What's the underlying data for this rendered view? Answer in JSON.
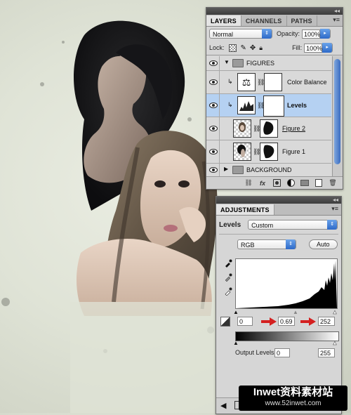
{
  "layers_panel": {
    "tabs": [
      "LAYERS",
      "CHANNELS",
      "PATHS"
    ],
    "blend_mode": "Normal",
    "opacity_label": "Opacity:",
    "opacity_value": "100%",
    "lock_label": "Lock:",
    "fill_label": "Fill:",
    "fill_value": "100%",
    "layers": [
      {
        "name": "FIGURES",
        "type": "group"
      },
      {
        "name": "Color Balance",
        "type": "adjustment"
      },
      {
        "name": "Levels",
        "type": "adjustment",
        "selected": true
      },
      {
        "name": "Figure 2",
        "type": "image"
      },
      {
        "name": "Figure 1",
        "type": "image"
      },
      {
        "name": "BACKGROUND",
        "type": "group"
      }
    ]
  },
  "adjustments_panel": {
    "tab": "ADJUSTMENTS",
    "title": "Levels",
    "preset": "Custom",
    "channel": "RGB",
    "auto_label": "Auto",
    "input_black": "0",
    "input_mid": "0.69",
    "input_white": "252",
    "output_label": "Output Levels:",
    "output_black": "0",
    "output_white": "255"
  },
  "watermark": {
    "brand": "Inwet资料素材站",
    "url": "www.52inwet.com"
  },
  "colors": {
    "panel_bg": "#d6d6d6",
    "selected_row": "#b5d1f2",
    "accent_blue": "#2d69c8",
    "red_arrow": "#d42020",
    "canvas_bg": "#e1e5d8"
  }
}
